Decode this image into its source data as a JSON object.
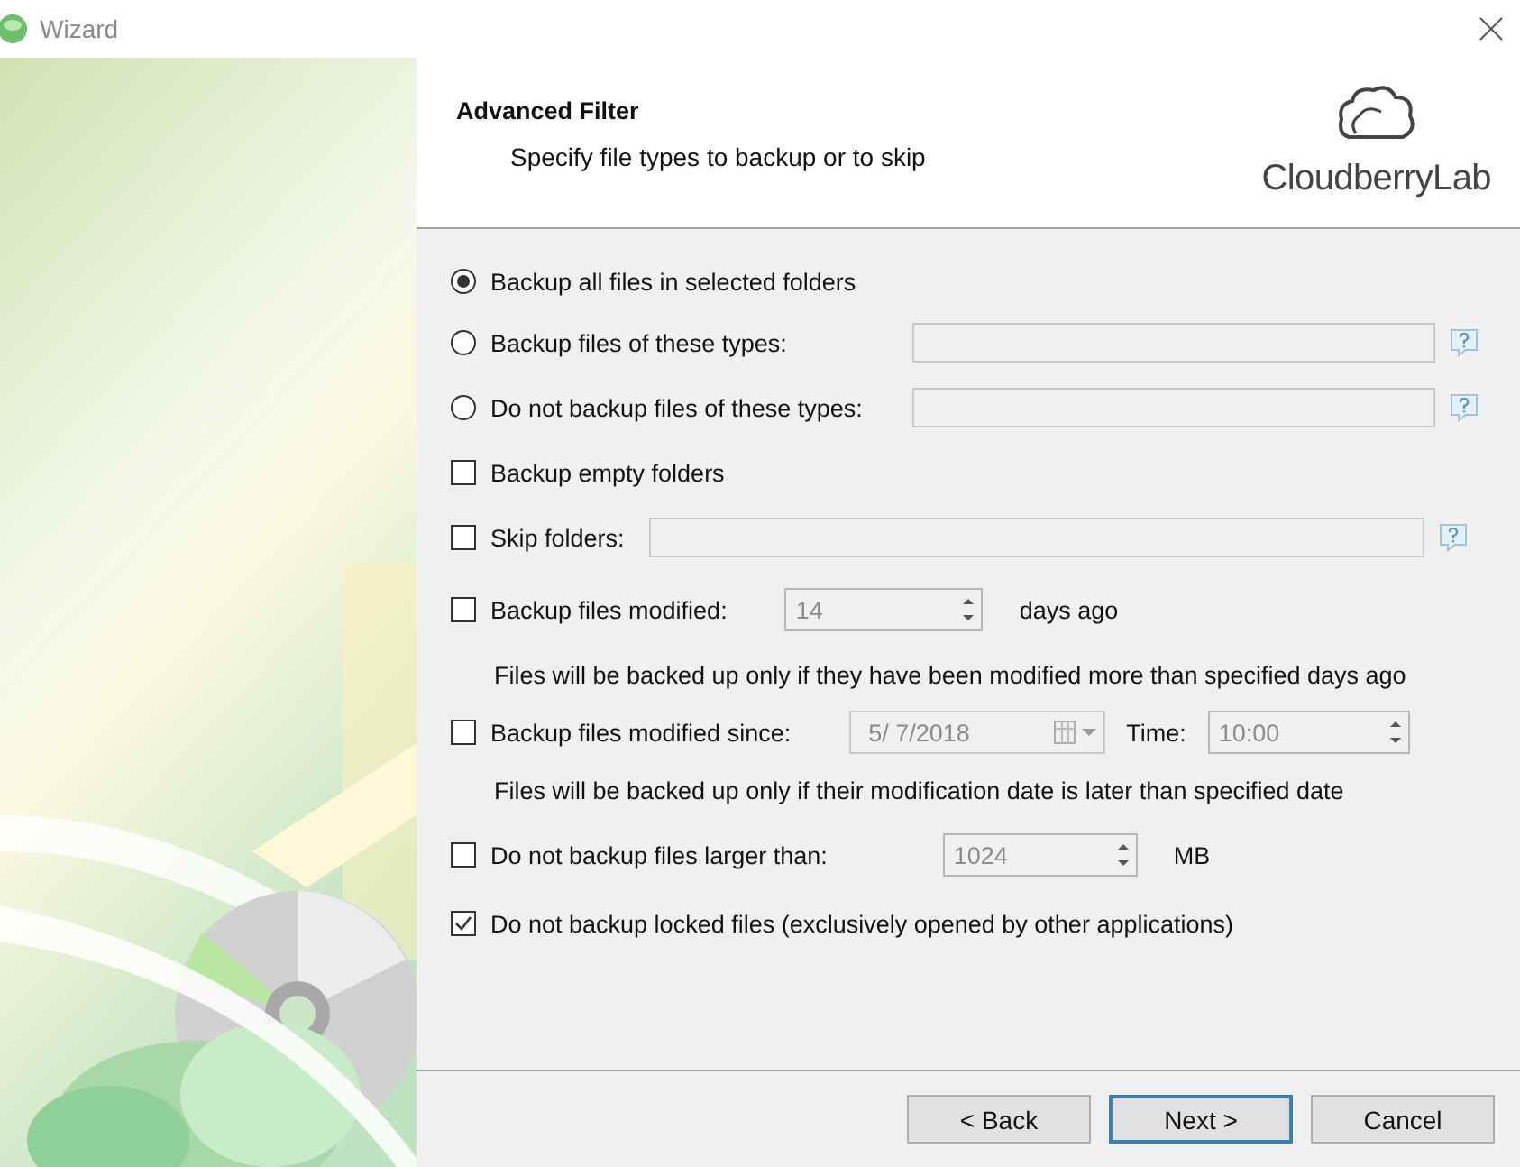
{
  "window": {
    "title": "Wizard"
  },
  "header": {
    "title": "Advanced Filter",
    "subtitle": "Specify file types to backup or to skip",
    "logo_text": "CloudberryLab"
  },
  "rows": [
    {
      "kind": "radio",
      "label": "Backup all files in selected folders",
      "selected": true
    },
    {
      "kind": "radio-field",
      "label": "Backup files of these types:",
      "selected": false
    },
    {
      "kind": "radio-field",
      "label": "Do not backup files of these types:",
      "selected": false
    },
    {
      "kind": "checkbox",
      "label": "Backup empty folders",
      "checked": false
    },
    {
      "kind": "checkbox-field",
      "label": "Skip folders:",
      "checked": false
    },
    {
      "kind": "checkbox",
      "label": "Backup files modified:",
      "checked": false,
      "spin": "14",
      "unit": "days ago"
    },
    {
      "kind": "note",
      "label": "Files will be backed up only if they have been modified more than specified days ago"
    },
    {
      "kind": "checkbox",
      "label": "Backup files modified since:",
      "checked": false,
      "date": "5/  7/2018",
      "time_label": "Time:",
      "time": "10:00"
    },
    {
      "kind": "note",
      "label": "Files will be backed up only if their modification date is later than specified date"
    },
    {
      "kind": "checkbox",
      "label": "Do not backup files larger than:",
      "checked": false,
      "spin": "1024",
      "unit": "MB"
    },
    {
      "kind": "checkbox",
      "label": "Do not backup locked files (exclusively opened by other applications)",
      "checked": true
    }
  ],
  "buttons": [
    {
      "label": "< Back",
      "default": false
    },
    {
      "label": "Next >",
      "default": true
    },
    {
      "label": "Cancel",
      "default": false
    }
  ]
}
